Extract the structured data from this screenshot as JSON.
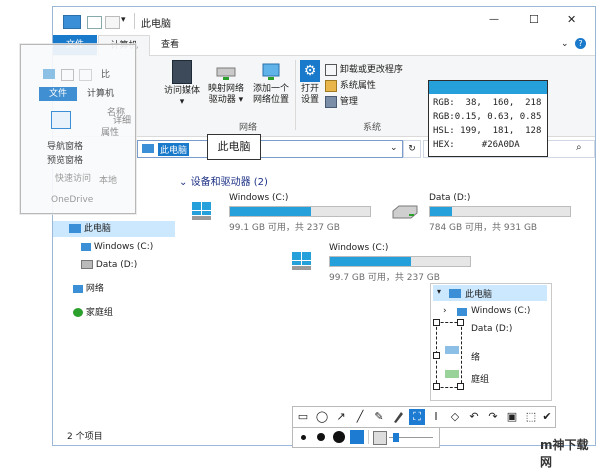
{
  "window": {
    "title": "此电脑",
    "tabs": [
      "文件",
      "计算机",
      "查看"
    ],
    "controls": {
      "minimize": "—",
      "maximize": "☐",
      "close": "✕"
    },
    "help": "?"
  },
  "ribbon": {
    "buttons": [
      {
        "label": "访问媒体",
        "sub": "▾"
      },
      {
        "label": "映射网络",
        "sub": "驱动器 ▾"
      },
      {
        "label": "添加一个",
        "sub": "网络位置"
      },
      {
        "label": "打开",
        "sub": "设置"
      }
    ],
    "group_network": "网络",
    "group_system": "系统",
    "small_items": [
      "卸载或更改程序",
      "系统属性",
      "管理"
    ]
  },
  "address": {
    "path": "此电脑",
    "tooltip": "此电脑"
  },
  "nav": {
    "items": [
      "此电脑",
      "Windows (C:)",
      "Data (D:)",
      "网络",
      "家庭组"
    ]
  },
  "content": {
    "group_title": "设备和驱动器 (2)",
    "drives": [
      {
        "name": "Windows (C:)",
        "info": "99.1 GB 可用，共 237 GB",
        "used": 0.58
      },
      {
        "name": "Data (D:)",
        "info": "784 GB 可用，共 931 GB",
        "used": 0.16
      },
      {
        "name": "Windows (C:)",
        "info": "99.7 GB 可用，共 237 GB",
        "used": 0.58
      }
    ]
  },
  "status": {
    "count": "2 个项目"
  },
  "ghost": {
    "tabs": [
      "文件",
      "计算机"
    ],
    "right_label": "比",
    "name_label": "名称",
    "detail": "详细",
    "prop": "属性",
    "nav_pane": "导航窗格",
    "preview_pane": "预览窗格",
    "quick": "快速访问",
    "onedrive": "OneDrive",
    "local": "本地"
  },
  "picker": {
    "color": "#26a0da",
    "rows": [
      {
        "label": "RGB:",
        "value": "  38,  160,  218"
      },
      {
        "label": "RGB:",
        "value": "0.15, 0.63, 0.85"
      },
      {
        "label": "HSL:",
        "value": " 199,  181,  128"
      },
      {
        "label": "HEX:",
        "value": "     #26A0DA"
      }
    ]
  },
  "magnifier": {
    "title": "此电脑",
    "items": [
      "Windows (C:)",
      "Data (D:)",
      "络",
      "庭组"
    ]
  },
  "toolbar": {
    "tools": [
      "▭",
      "◯",
      "↗",
      "╱",
      "✎",
      "⛶",
      "I",
      "◇",
      "↶",
      "↷",
      "▣",
      "⬚",
      "✔"
    ]
  },
  "watermark": "m神下载网"
}
